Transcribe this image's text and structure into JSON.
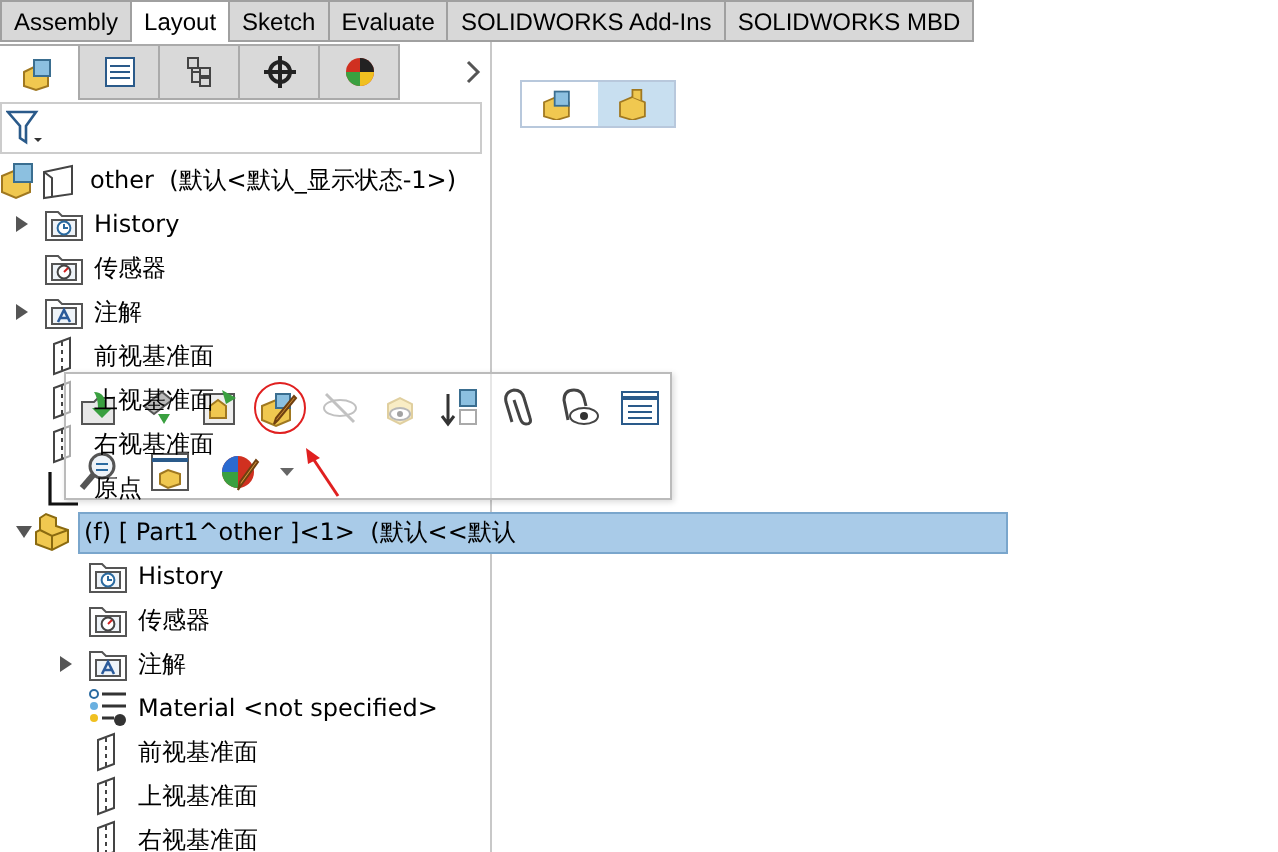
{
  "ribbon_tabs": [
    {
      "label": "Assembly",
      "selected": false
    },
    {
      "label": "Layout",
      "selected": true
    },
    {
      "label": "Sketch",
      "selected": false
    },
    {
      "label": "Evaluate",
      "selected": false
    },
    {
      "label": "SOLIDWORKS Add-Ins",
      "selected": false
    },
    {
      "label": "SOLIDWORKS MBD",
      "selected": false
    }
  ],
  "panel_tabs": [
    {
      "kind": "feature-tree",
      "selected": true
    },
    {
      "kind": "property",
      "selected": false
    },
    {
      "kind": "config",
      "selected": false
    },
    {
      "kind": "dimxpert",
      "selected": false
    },
    {
      "kind": "display",
      "selected": false
    }
  ],
  "tree": [
    {
      "label": "other",
      "suffix": "(默认<默认_显示状态-1>)",
      "kind": "assembly",
      "selected": false,
      "children": [
        {
          "label": "History",
          "kind": "history",
          "expanded": false,
          "selected": false
        },
        {
          "label": "传感器",
          "kind": "sensor",
          "selected": false
        },
        {
          "label": "注解",
          "kind": "annotation",
          "expanded": false,
          "selected": false
        },
        {
          "label": "前视基准面",
          "kind": "plane",
          "selected": false
        },
        {
          "label": "上视基准面",
          "kind": "plane",
          "selected": false
        },
        {
          "label": "右视基准面",
          "kind": "plane",
          "selected": false
        },
        {
          "label": "原点",
          "kind": "origin",
          "selected": false
        },
        {
          "label": "(f) [ Part1^other ]<1>",
          "suffix": "(默认<<默认",
          "kind": "part",
          "expanded": true,
          "selected": true,
          "children": [
            {
              "label": "History",
              "kind": "history",
              "selected": false
            },
            {
              "label": "传感器",
              "kind": "sensor",
              "selected": false
            },
            {
              "label": "注解",
              "kind": "annotation",
              "expanded": false,
              "selected": false
            },
            {
              "label": "Material <not specified>",
              "kind": "material",
              "selected": false
            },
            {
              "label": "前视基准面",
              "kind": "plane",
              "selected": false
            },
            {
              "label": "上视基准面",
              "kind": "plane",
              "selected": false
            },
            {
              "label": "右视基准面",
              "kind": "plane",
              "selected": false
            }
          ]
        }
      ]
    }
  ],
  "context_toolbar": {
    "rows": [
      [
        {
          "kind": "insert",
          "disabled": false,
          "highlighted": false
        },
        {
          "kind": "cylinder",
          "disabled": false,
          "highlighted": false
        },
        {
          "kind": "replace",
          "disabled": false,
          "highlighted": false
        },
        {
          "kind": "edit-part",
          "disabled": false,
          "highlighted": true
        },
        {
          "kind": "hide",
          "disabled": true,
          "highlighted": false
        },
        {
          "kind": "show",
          "disabled": true,
          "highlighted": false
        },
        {
          "kind": "move-down",
          "disabled": false,
          "highlighted": false
        },
        {
          "kind": "clip",
          "disabled": false,
          "highlighted": false
        },
        {
          "kind": "eye",
          "disabled": false,
          "highlighted": false
        },
        {
          "kind": "list",
          "disabled": false,
          "highlighted": false
        }
      ],
      [
        {
          "kind": "zoom",
          "disabled": false,
          "highlighted": false
        },
        {
          "kind": "part-window",
          "disabled": false,
          "highlighted": false
        },
        {
          "kind": "appearance",
          "disabled": false,
          "highlighted": false,
          "dropdown": true
        }
      ]
    ]
  },
  "breadcrumb": [
    {
      "kind": "assembly",
      "selected": false
    },
    {
      "kind": "part",
      "selected": true
    }
  ]
}
